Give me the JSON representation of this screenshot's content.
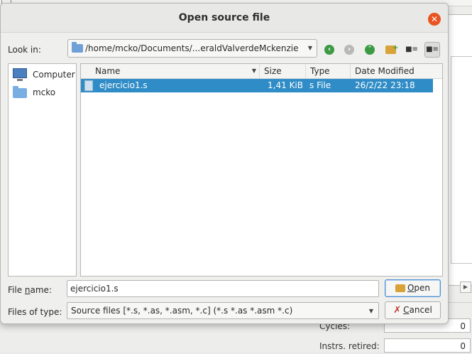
{
  "dialog": {
    "title": "Open source file",
    "look_in_label": "Look in:",
    "path": "/home/mcko/Documents/...eraldValverdeMckenzie"
  },
  "sidebar": {
    "items": [
      {
        "label": "Computer",
        "icon": "computer-icon"
      },
      {
        "label": "mcko",
        "icon": "folder-icon"
      }
    ]
  },
  "file_list": {
    "columns": [
      "Name",
      "Size",
      "Type",
      "Date Modified"
    ],
    "rows": [
      {
        "name": "ejercicio1.s",
        "size": "1,41 KiB",
        "type": "s File",
        "date": "26/2/22 23:18",
        "selected": true
      }
    ]
  },
  "file_name": {
    "label_prefix": "File ",
    "label_accel": "n",
    "label_suffix": "ame:",
    "value": "ejercicio1.s"
  },
  "file_type": {
    "label": "Files of type:",
    "value": "Source files [*.s, *.as, *.asm, *.c] (*.s *.as *.asm *.c)"
  },
  "buttons": {
    "open_accel": "O",
    "open_rest": "pen",
    "cancel_accel": "C",
    "cancel_rest": "ancel"
  },
  "background": {
    "cycles_label": "Cycles:",
    "cycles_value": "0",
    "instrs_label": "Instrs. retired:",
    "instrs_value": "0"
  },
  "colors": {
    "selection": "#308cc6",
    "close_button": "#e95420",
    "nav_green": "#3d9a43"
  }
}
